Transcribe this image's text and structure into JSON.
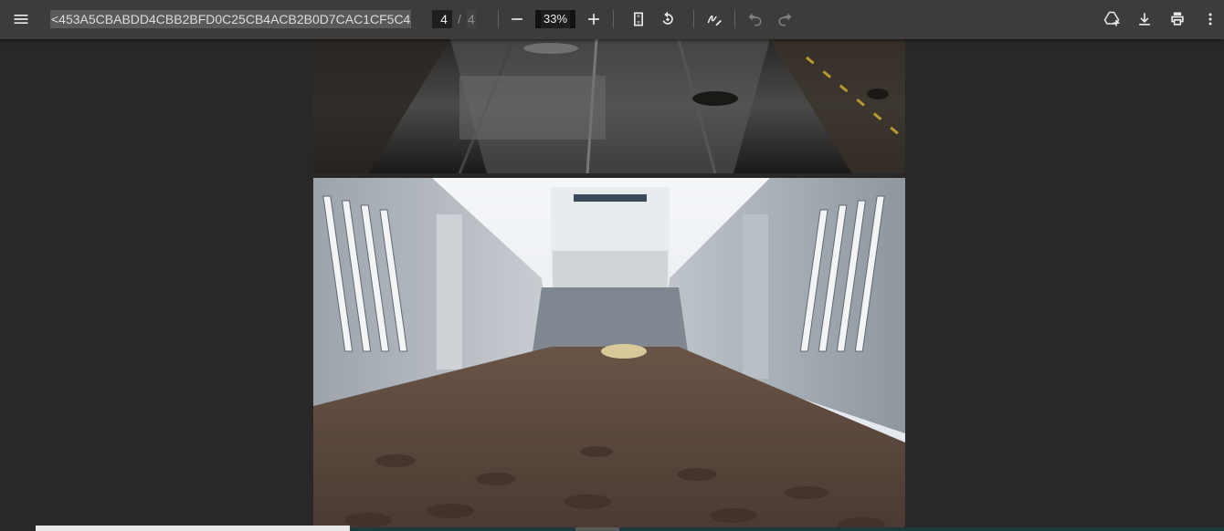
{
  "toolbar": {
    "menu_icon": "hamburger-menu-icon",
    "document_title": "<453A5CBABDD4CBB2BFD0C25CB4ACB2B0D7CAC1CF5C4A4...",
    "page_current": "4",
    "page_separator": "/",
    "page_total": "4",
    "zoom_level": "33%",
    "icons": {
      "zoom_out": "minus-icon",
      "zoom_in": "plus-icon",
      "fit_page": "fit-to-page-icon",
      "rotate": "rotate-counterclockwise-icon",
      "annotate": "pen-annotate-icon",
      "undo": "undo-icon",
      "redo": "redo-icon",
      "save_drive": "add-to-drive-icon",
      "download": "download-icon",
      "print": "print-icon",
      "more": "more-vert-icon"
    }
  },
  "colors": {
    "toolbar_bg": "#3c3c3c",
    "viewer_bg": "#282828",
    "icon": "#e8eaed"
  }
}
